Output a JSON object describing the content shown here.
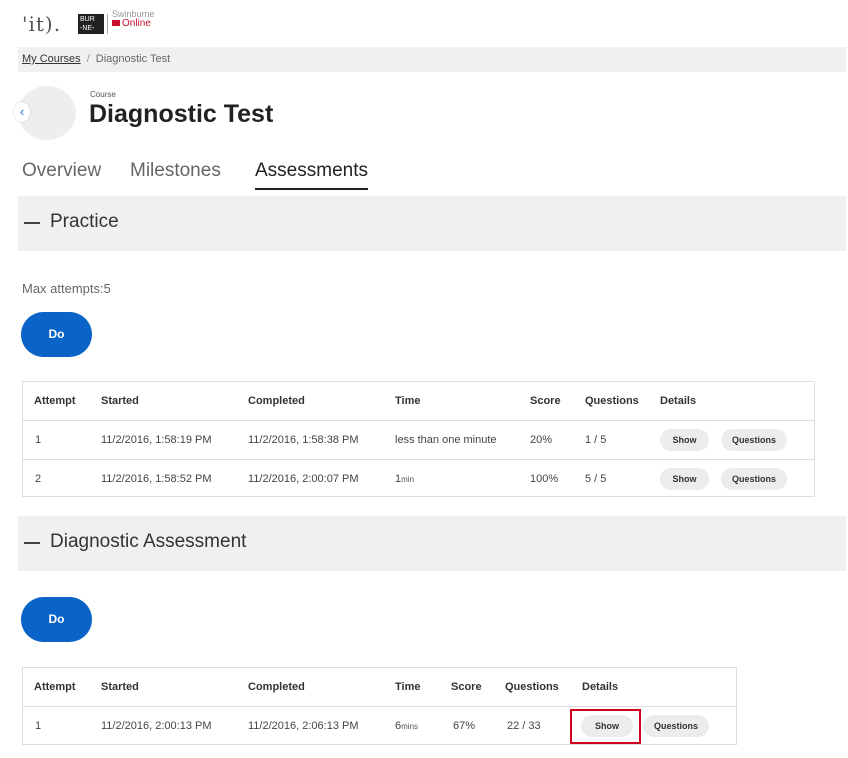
{
  "header": {
    "logo_it": "'it).",
    "logo_box": "BUR\n-NE-",
    "logo_swin_top": "Swinburne",
    "logo_swin_bottom": "Online"
  },
  "breadcrumb": {
    "items": [
      "My Courses",
      "Diagnostic Test"
    ],
    "separator": "/"
  },
  "course": {
    "label": "Course",
    "title": "Diagnostic Test"
  },
  "tabs": [
    {
      "label": "Overview",
      "active": false
    },
    {
      "label": "Milestones",
      "active": false
    },
    {
      "label": "Assessments",
      "active": true
    }
  ],
  "practice": {
    "title": "Practice",
    "max_attempts": "Max attempts:5",
    "do_label": "Do",
    "columns": [
      "Attempt",
      "Started",
      "Completed",
      "Time",
      "Score",
      "Questions",
      "Details"
    ],
    "rows": [
      {
        "attempt": "1",
        "started": "11/2/2016, 1:58:19 PM",
        "completed": "11/2/2016, 1:58:38 PM",
        "time": "less than one minute",
        "time_unit": "",
        "score": "20%",
        "questions": "1 / 5",
        "show": "Show",
        "questions_btn": "Questions"
      },
      {
        "attempt": "2",
        "started": "11/2/2016, 1:58:52 PM",
        "completed": "11/2/2016, 2:00:07 PM",
        "time": "1",
        "time_unit": "min",
        "score": "100%",
        "questions": "5 / 5",
        "show": "Show",
        "questions_btn": "Questions"
      }
    ]
  },
  "diagnostic": {
    "title": "Diagnostic Assessment",
    "do_label": "Do",
    "columns": [
      "Attempt",
      "Started",
      "Completed",
      "Time",
      "Score",
      "Questions",
      "Details"
    ],
    "rows": [
      {
        "attempt": "1",
        "started": "11/2/2016, 2:00:13 PM",
        "completed": "11/2/2016, 2:06:13 PM",
        "time": "6",
        "time_unit": "mins",
        "score": "67%",
        "questions": "22 / 33",
        "show": "Show",
        "questions_btn": "Questions"
      }
    ]
  },
  "colors": {
    "primary": "#0a64c8",
    "highlight": "#d0021b",
    "section_bg": "#f0f0f0"
  }
}
